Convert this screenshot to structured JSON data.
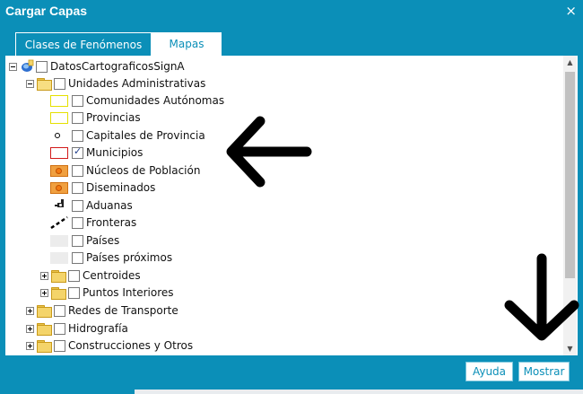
{
  "window": {
    "title": "Cargar Capas",
    "close_glyph": "×"
  },
  "tabs": [
    {
      "label": "Clases de Fenómenos",
      "active": true
    },
    {
      "label": "Mapas",
      "active": false
    }
  ],
  "tree": {
    "root": {
      "label": "DatosCartograficosSignA",
      "expanded": true,
      "checked": false
    },
    "admin": {
      "label": "Unidades Administrativas",
      "expanded": true,
      "checked": false
    },
    "layers": [
      {
        "label": "Comunidades Autónomas",
        "symbol": "yellow-outline-box",
        "checked": false
      },
      {
        "label": "Provincias",
        "symbol": "yellow-outline-box",
        "checked": false
      },
      {
        "label": "Capitales de Provincia",
        "symbol": "black-dot",
        "checked": false
      },
      {
        "label": "Municipios",
        "symbol": "red-outline-box",
        "checked": true
      },
      {
        "label": "Núcleos de Población",
        "symbol": "orange-circle",
        "checked": false
      },
      {
        "label": "Diseminados",
        "symbol": "orange-circle",
        "checked": false
      },
      {
        "label": "Aduanas",
        "symbol": "customs-icon",
        "checked": false
      },
      {
        "label": "Fronteras",
        "symbol": "dashed-line",
        "checked": false
      },
      {
        "label": "Países",
        "symbol": "grey-box",
        "checked": false
      },
      {
        "label": "Países próximos",
        "symbol": "grey-box",
        "checked": false
      }
    ],
    "sub_groups": [
      {
        "label": "Centroides",
        "expanded": false,
        "checked": false
      },
      {
        "label": "Puntos Interiores",
        "expanded": false,
        "checked": false
      }
    ],
    "groups": [
      {
        "label": "Redes de Transporte",
        "expanded": false,
        "checked": false
      },
      {
        "label": "Hidrografía",
        "expanded": false,
        "checked": false
      },
      {
        "label": "Construcciones y Otros",
        "expanded": false,
        "checked": false
      }
    ]
  },
  "scrollbar": {
    "up_glyph": "▲",
    "down_glyph": "▼"
  },
  "buttons": {
    "help": "Ayuda",
    "show": "Mostrar"
  },
  "colors": {
    "accent": "#0b8fb8",
    "annotation": "#000000"
  }
}
